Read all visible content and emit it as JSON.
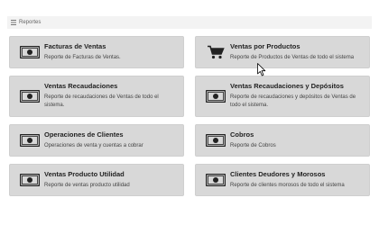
{
  "breadcrumb": {
    "icon": "list-icon",
    "label": "Reportes"
  },
  "cards": [
    {
      "icon": "money-icon",
      "title": "Facturas de Ventas",
      "description": "Reporte de Facturas de Ventas."
    },
    {
      "icon": "cart-icon",
      "title": "Ventas por Productos",
      "description": "Reporte de Productos de Ventas de todo el sistema"
    },
    {
      "icon": "money-icon",
      "title": "Ventas Recaudaciones",
      "description": "Reporte de recaudaciones de Ventas de todo el sistema."
    },
    {
      "icon": "money-icon",
      "title": "Ventas Recaudaciones y Depósitos",
      "description": "Reporte de recaudaciones y depósitos de Ventas de todo el sistema."
    },
    {
      "icon": "money-icon",
      "title": "Operaciones de Clientes",
      "description": "Operaciones de venta y cuentas a cobrar"
    },
    {
      "icon": "money-icon",
      "title": "Cobros",
      "description": "Reporte de Cobros"
    },
    {
      "icon": "money-icon",
      "title": "Ventas Producto Utilidad",
      "description": "Reporte de ventas producto utilidad"
    },
    {
      "icon": "money-icon",
      "title": "Clientes Deudores y Morosos",
      "description": "Reporte de clientes morosos de todo el sistema"
    }
  ]
}
